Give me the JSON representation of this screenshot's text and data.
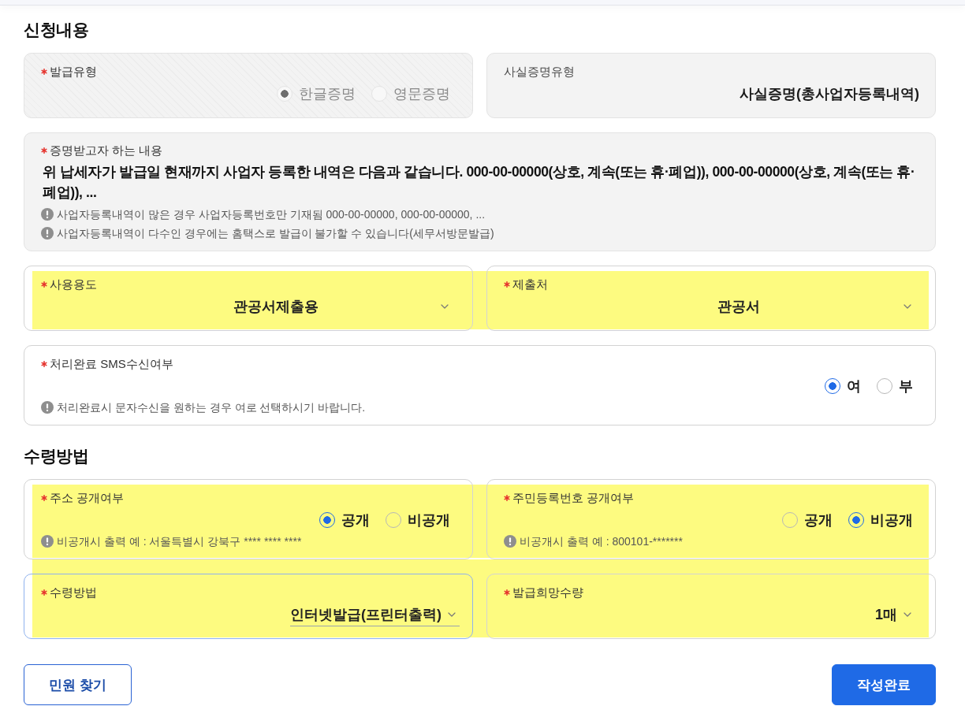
{
  "sections": [
    {
      "title": "신청내용",
      "rows": [
        {
          "highlighted": false,
          "fields": [
            {
              "kind": "radio",
              "label": "발급유형",
              "required": true,
              "disabled": true,
              "options": [
                {
                  "label": "한글증명",
                  "selected": true
                },
                {
                  "label": "영문증명",
                  "selected": false
                }
              ]
            },
            {
              "kind": "display",
              "label": "사실증명유형",
              "required": false,
              "value": "사실증명(총사업자등록내역)"
            }
          ]
        },
        {
          "highlighted": false,
          "fields": [
            {
              "kind": "text",
              "label": "증명받고자 하는 내용",
              "required": true,
              "value": "위 납세자가 발급일 현재까지 사업자 등록한 내역은 다음과 같습니다. 000-00-00000(상호, 계속(또는 휴·폐업)), 000-00-00000(상호, 계속(또는 휴·폐업)), ...",
              "notes": [
                "사업자등록내역이 많은 경우 사업자등록번호만 기재됨 000-00-00000, 000-00-00000, ...",
                "사업자등록내역이 다수인 경우에는 홈택스로 발급이 불가할 수 있습니다(세무서방문발급)"
              ]
            }
          ]
        },
        {
          "highlighted": true,
          "fields": [
            {
              "kind": "select",
              "label": "사용용도",
              "required": true,
              "focused": false,
              "value": "관공서제출용"
            },
            {
              "kind": "select",
              "label": "제출처",
              "required": true,
              "focused": false,
              "value": "관공서"
            }
          ]
        },
        {
          "highlighted": false,
          "fields": [
            {
              "kind": "radio",
              "label": "처리완료 SMS수신여부",
              "required": true,
              "disabled": false,
              "options": [
                {
                  "label": "여",
                  "selected": true
                },
                {
                  "label": "부",
                  "selected": false
                }
              ],
              "notes": [
                "처리완료시 문자수신을 원하는 경우 여로 선택하시기 바랍니다."
              ]
            }
          ]
        }
      ]
    },
    {
      "title": "수령방법",
      "rows": [
        {
          "highlighted": true,
          "fields": [
            {
              "kind": "radio",
              "label": "주소 공개여부",
              "required": true,
              "disabled": false,
              "options": [
                {
                  "label": "공개",
                  "selected": true
                },
                {
                  "label": "비공개",
                  "selected": false
                }
              ],
              "notes": [
                "비공개시 출력 예 : 서울특별시 강북구 **** **** ****"
              ]
            },
            {
              "kind": "radio",
              "label": "주민등록번호 공개여부",
              "required": true,
              "disabled": false,
              "options": [
                {
                  "label": "공개",
                  "selected": false
                },
                {
                  "label": "비공개",
                  "selected": true
                }
              ],
              "notes": [
                "비공개시 출력 예 : 800101-*******"
              ]
            }
          ]
        },
        {
          "highlighted": true,
          "fields": [
            {
              "kind": "select",
              "label": "수령방법",
              "required": true,
              "focused": true,
              "value": "인터넷발급(프린터출력)"
            },
            {
              "kind": "dropdown",
              "label": "발급희망수량",
              "required": true,
              "value": "1매"
            }
          ]
        }
      ]
    }
  ],
  "buttons": [
    {
      "label": "민원 찾기",
      "kind": "secondary"
    },
    {
      "label": "작성완료",
      "kind": "primary"
    }
  ]
}
